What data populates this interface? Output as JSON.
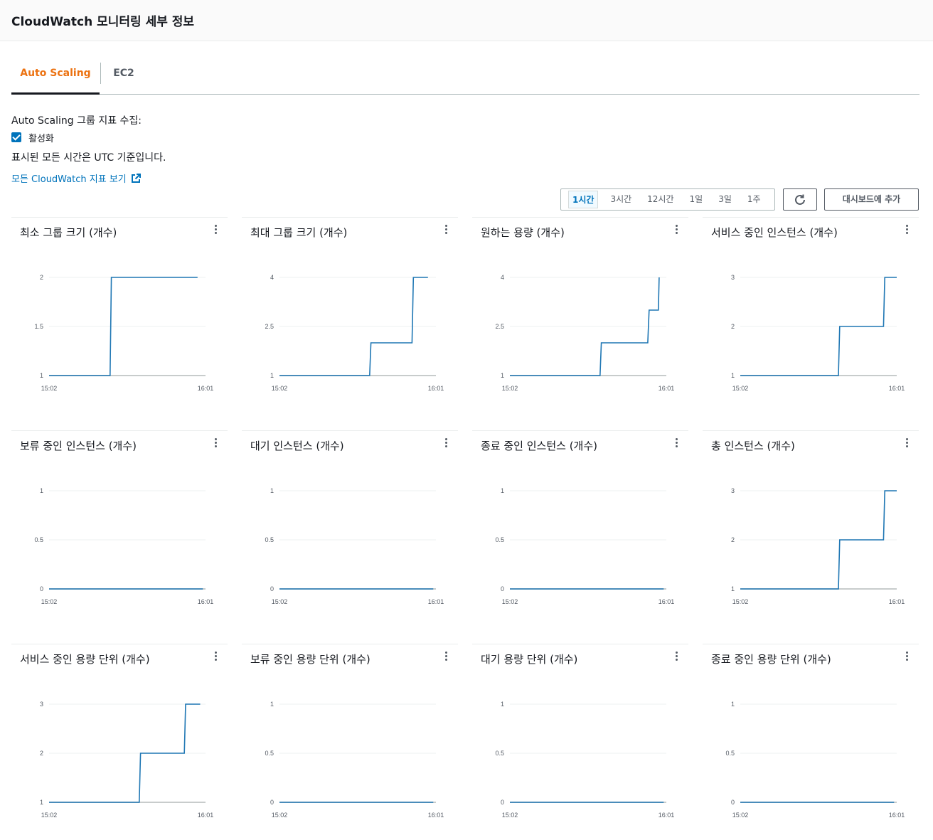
{
  "header": {
    "title": "CloudWatch 모니터링 세부 정보"
  },
  "tabs": [
    {
      "label": "Auto Scaling",
      "active": true
    },
    {
      "label": "EC2",
      "active": false
    }
  ],
  "collection": {
    "label": "Auto Scaling 그룹 지표 수집:",
    "checkbox_label": "활성화",
    "checked": true
  },
  "utc_note": "표시된 모든 시간은 UTC 기준입니다.",
  "link_label": "모든 CloudWatch 지표 보기",
  "time_ranges": [
    "1시간",
    "3시간",
    "12시간",
    "1일",
    "3일",
    "1주"
  ],
  "selected_range": "1시간",
  "dashboard_button": "대시보드에 추가",
  "colors": {
    "accent": "#ec7211",
    "link": "#0073bb",
    "series": "#1f77b4"
  },
  "chart_data": [
    {
      "type": "line",
      "title": "최소 그룹 크기 (개수)",
      "x_ticks": [
        "15:02",
        "16:01"
      ],
      "y_ticks": [
        "1",
        "1.5",
        "2"
      ],
      "ylim": [
        1,
        2
      ],
      "xlim": [
        0,
        59
      ],
      "series": [
        {
          "points": [
            [
              0,
              1
            ],
            [
              23,
              1
            ],
            [
              23.5,
              2
            ],
            [
              56,
              2
            ]
          ]
        }
      ]
    },
    {
      "type": "line",
      "title": "최대 그룹 크기 (개수)",
      "x_ticks": [
        "15:02",
        "16:01"
      ],
      "y_ticks": [
        "1",
        "2.5",
        "4"
      ],
      "ylim": [
        1,
        4
      ],
      "xlim": [
        0,
        59
      ],
      "series": [
        {
          "points": [
            [
              0,
              1
            ],
            [
              34,
              1
            ],
            [
              34.5,
              2
            ],
            [
              50,
              2
            ],
            [
              50.5,
              4
            ],
            [
              56,
              4
            ]
          ]
        }
      ]
    },
    {
      "type": "line",
      "title": "원하는 용량 (개수)",
      "x_ticks": [
        "15:02",
        "16:01"
      ],
      "y_ticks": [
        "1",
        "2.5",
        "4"
      ],
      "ylim": [
        1,
        4
      ],
      "xlim": [
        0,
        59
      ],
      "series": [
        {
          "points": [
            [
              0,
              1
            ],
            [
              34,
              1
            ],
            [
              34.5,
              2
            ],
            [
              52,
              2
            ],
            [
              52.5,
              3
            ],
            [
              56,
              3
            ],
            [
              56.3,
              4
            ]
          ]
        }
      ]
    },
    {
      "type": "line",
      "title": "서비스 중인 인스턴스 (개수)",
      "x_ticks": [
        "15:02",
        "16:01"
      ],
      "y_ticks": [
        "1",
        "2",
        "3"
      ],
      "ylim": [
        1,
        3
      ],
      "xlim": [
        0,
        59
      ],
      "series": [
        {
          "points": [
            [
              0,
              1
            ],
            [
              37,
              1
            ],
            [
              37.5,
              2
            ],
            [
              54,
              2
            ],
            [
              54.5,
              3
            ],
            [
              59,
              3
            ]
          ]
        }
      ]
    },
    {
      "type": "line",
      "title": "보류 중인 인스턴스 (개수)",
      "x_ticks": [
        "15:02",
        "16:01"
      ],
      "y_ticks": [
        "0",
        "0.5",
        "1"
      ],
      "ylim": [
        0,
        1
      ],
      "xlim": [
        0,
        59
      ],
      "series": [
        {
          "points": [
            [
              0,
              0
            ],
            [
              58,
              0
            ]
          ]
        }
      ]
    },
    {
      "type": "line",
      "title": "대기 인스턴스 (개수)",
      "x_ticks": [
        "15:02",
        "16:01"
      ],
      "y_ticks": [
        "0",
        "0.5",
        "1"
      ],
      "ylim": [
        0,
        1
      ],
      "xlim": [
        0,
        59
      ],
      "series": [
        {
          "points": [
            [
              0,
              0
            ],
            [
              58,
              0
            ]
          ]
        }
      ]
    },
    {
      "type": "line",
      "title": "종료 중인 인스턴스 (개수)",
      "x_ticks": [
        "15:02",
        "16:01"
      ],
      "y_ticks": [
        "0",
        "0.5",
        "1"
      ],
      "ylim": [
        0,
        1
      ],
      "xlim": [
        0,
        59
      ],
      "series": [
        {
          "points": [
            [
              0,
              0
            ],
            [
              58,
              0
            ]
          ]
        }
      ]
    },
    {
      "type": "line",
      "title": "총 인스턴스 (개수)",
      "x_ticks": [
        "15:02",
        "16:01"
      ],
      "y_ticks": [
        "1",
        "2",
        "3"
      ],
      "ylim": [
        1,
        3
      ],
      "xlim": [
        0,
        59
      ],
      "series": [
        {
          "points": [
            [
              0,
              1
            ],
            [
              37,
              1
            ],
            [
              37.5,
              2
            ],
            [
              54,
              2
            ],
            [
              54.5,
              3
            ],
            [
              59,
              3
            ]
          ]
        }
      ]
    },
    {
      "type": "line",
      "title": "서비스 중인 용량 단위 (개수)",
      "x_ticks": [
        "15:02",
        "16:01"
      ],
      "y_ticks": [
        "1",
        "2",
        "3"
      ],
      "ylim": [
        1,
        3
      ],
      "xlim": [
        0,
        59
      ],
      "series": [
        {
          "points": [
            [
              0,
              1
            ],
            [
              34,
              1
            ],
            [
              34.5,
              2
            ],
            [
              51,
              2
            ],
            [
              51.5,
              3
            ],
            [
              57,
              3
            ]
          ]
        }
      ]
    },
    {
      "type": "line",
      "title": "보류 중인 용량 단위 (개수)",
      "x_ticks": [
        "15:02",
        "16:01"
      ],
      "y_ticks": [
        "0",
        "0.5",
        "1"
      ],
      "ylim": [
        0,
        1
      ],
      "xlim": [
        0,
        59
      ],
      "series": [
        {
          "points": [
            [
              0,
              0
            ],
            [
              58,
              0
            ]
          ]
        }
      ]
    },
    {
      "type": "line",
      "title": "대기 용량 단위 (개수)",
      "x_ticks": [
        "15:02",
        "16:01"
      ],
      "y_ticks": [
        "0",
        "0.5",
        "1"
      ],
      "ylim": [
        0,
        1
      ],
      "xlim": [
        0,
        59
      ],
      "series": [
        {
          "points": [
            [
              0,
              0
            ],
            [
              58,
              0
            ]
          ]
        }
      ]
    },
    {
      "type": "line",
      "title": "종료 중인 용량 단위 (개수)",
      "x_ticks": [
        "15:02",
        "16:01"
      ],
      "y_ticks": [
        "0",
        "0.5",
        "1"
      ],
      "ylim": [
        0,
        1
      ],
      "xlim": [
        0,
        59
      ],
      "series": [
        {
          "points": [
            [
              0,
              0
            ],
            [
              58,
              0
            ]
          ]
        }
      ]
    }
  ]
}
